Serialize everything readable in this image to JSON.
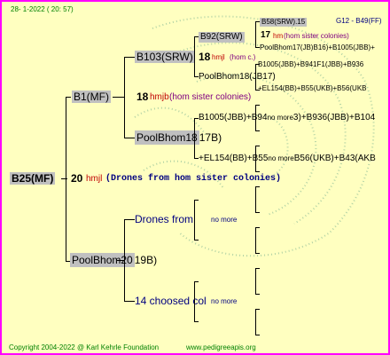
{
  "header": {
    "date": "28-  1-2022 ( 20: 57)",
    "g12": "G12 - B49(FF)"
  },
  "root": {
    "label": "B25(MF)",
    "num": "20",
    "hmjl": "hmjl",
    "note": "(Drones from hom sister colonies)"
  },
  "gen1": {
    "top": {
      "label": "B1(MF)",
      "num": "18",
      "hmjb": "hmjb",
      "note": "(hom sister colonies)"
    },
    "bottom": {
      "label": "PoolBhom20",
      "suffix": "19B)"
    }
  },
  "gen2": {
    "a": {
      "label": "B103(SRW)",
      "num": "18",
      "hmjl": "hmjl",
      "note": "(hom c.)"
    },
    "b": {
      "label": "PoolBhom18",
      "suffix": "17B)"
    },
    "c": {
      "label": "Drones from",
      "nomore": "no more"
    },
    "d": {
      "label": "14 choosed col",
      "nomore": "no more"
    }
  },
  "gen3": {
    "a": "B92(SRW)",
    "b": "PoolBhom18(JB17)",
    "c": "B1005(JBB)+B94",
    "c_nomore": "no more",
    "c_tail": "3)+B936(JBB)+B104",
    "d": "+EL154(BB)+B55",
    "d_nomore": "no more",
    "d_tail": "B56(UKB)+B43(AKB"
  },
  "gen4": {
    "a": "B58(SRW).15",
    "b_num": "17",
    "b_hm": "hm",
    "b_note": "(hom sister colonies)",
    "c": "PoolBhom17(JB)",
    "c_tail": "B16)+B1005(JBB)+",
    "d": "B1005(JBB)+B941F1(JBB)+B936",
    "e": "+EL154(BB)+B55(UKB)+B56(UKB"
  },
  "footer": {
    "copyright": "Copyright 2004-2022 @ Karl Kehrle Foundation",
    "site": "www.pedigreeapis.org"
  },
  "colors": {
    "border": "#ff00ff",
    "background": "#ffffc0",
    "box": "#c0c0c0",
    "header": "#008000",
    "dark_blue": "#000080",
    "red": "#c00000"
  }
}
